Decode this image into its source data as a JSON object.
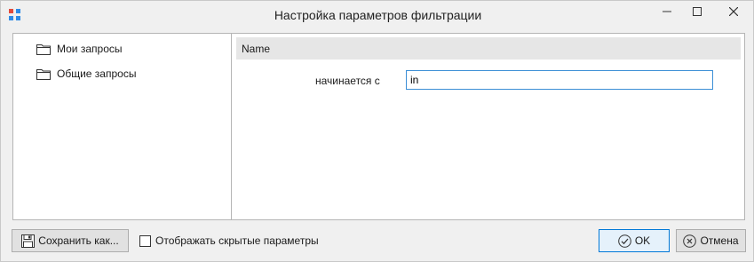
{
  "window": {
    "title": "Настройка параметров фильтрации",
    "minimize_glyph": "−",
    "maximize_glyph": "☐",
    "close_glyph": "✕"
  },
  "tree": {
    "items": [
      {
        "label": "Мои запросы",
        "icon": "folder-icon"
      },
      {
        "label": "Общие запросы",
        "icon": "folder-icon"
      }
    ]
  },
  "filter": {
    "section_title": "Name",
    "condition_label": "начинается с",
    "value": "in"
  },
  "footer": {
    "save_label": "Сохранить как...",
    "show_hidden_label": "Отображать скрытые параметры",
    "show_hidden_checked": false,
    "ok_label": "OK",
    "cancel_label": "Отмена"
  },
  "colors": {
    "accent": "#0078d7",
    "app_icon_red": "#e24a3b",
    "app_icon_blue": "#2f8be6"
  }
}
